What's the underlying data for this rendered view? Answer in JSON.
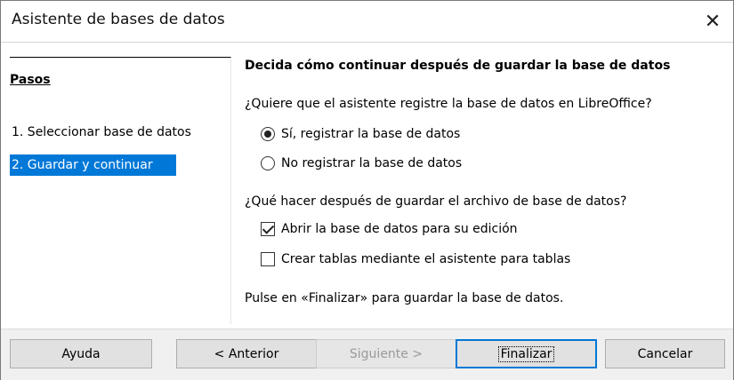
{
  "window": {
    "title": "Asistente de bases de datos",
    "close_glyph": "✕"
  },
  "steps": {
    "title": "Pasos",
    "items": [
      {
        "label": "1. Seleccionar base de datos",
        "active": false
      },
      {
        "label": "2. Guardar y continuar",
        "active": true
      }
    ]
  },
  "content": {
    "heading": "Decida cómo continuar después de guardar la base de datos",
    "register_question": "¿Quiere que el asistente registre la base de datos en LibreOffice?",
    "register_options": [
      {
        "label": "Sí, registrar la base de datos",
        "selected": true
      },
      {
        "label": "No registrar la base de datos",
        "selected": false
      }
    ],
    "after_save_question": "¿Qué hacer después de guardar el archivo de base de datos?",
    "after_save_options": [
      {
        "label": "Abrir la base de datos para su edición",
        "checked": true
      },
      {
        "label": "Crear tablas mediante el asistente para tablas",
        "checked": false
      }
    ],
    "final_note": "Pulse en «Finalizar» para guardar la base de datos."
  },
  "buttons": {
    "help": "Ayuda",
    "previous": "< Anterior",
    "next": "Siguiente >",
    "finish": "Finalizar",
    "cancel": "Cancelar"
  },
  "colors": {
    "selection": "#0078d7",
    "default_button_border": "#0078d7"
  }
}
